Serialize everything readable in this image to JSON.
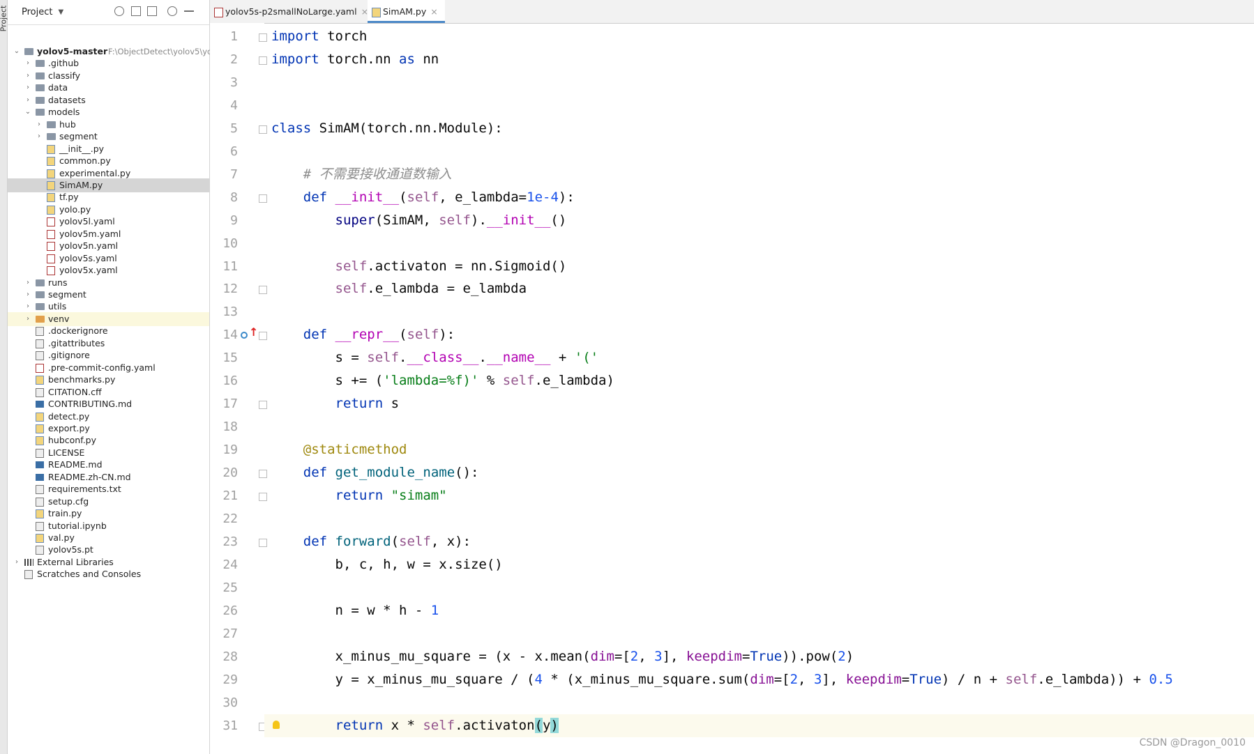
{
  "side_stripe": {
    "label": "Project"
  },
  "project_panel": {
    "title": "Project",
    "tree": [
      {
        "label": "yolov5-master",
        "hint": "F:\\ObjectDetect\\yolov5\\yol",
        "type": "folder",
        "depth": 0,
        "expanded": true,
        "bold": true
      },
      {
        "label": ".github",
        "type": "folder",
        "depth": 1
      },
      {
        "label": "classify",
        "type": "folder",
        "depth": 1
      },
      {
        "label": "data",
        "type": "folder",
        "depth": 1
      },
      {
        "label": "datasets",
        "type": "folder",
        "depth": 1
      },
      {
        "label": "models",
        "type": "folder",
        "depth": 1,
        "expanded": true
      },
      {
        "label": "hub",
        "type": "folder",
        "depth": 2
      },
      {
        "label": "segment",
        "type": "folder",
        "depth": 2
      },
      {
        "label": "__init__.py",
        "type": "py",
        "depth": 2,
        "leaf": true
      },
      {
        "label": "common.py",
        "type": "py",
        "depth": 2,
        "leaf": true
      },
      {
        "label": "experimental.py",
        "type": "py",
        "depth": 2,
        "leaf": true
      },
      {
        "label": "SimAM.py",
        "type": "py",
        "depth": 2,
        "leaf": true,
        "selected": true
      },
      {
        "label": "tf.py",
        "type": "py",
        "depth": 2,
        "leaf": true
      },
      {
        "label": "yolo.py",
        "type": "py",
        "depth": 2,
        "leaf": true
      },
      {
        "label": "yolov5l.yaml",
        "type": "yaml",
        "depth": 2,
        "leaf": true
      },
      {
        "label": "yolov5m.yaml",
        "type": "yaml",
        "depth": 2,
        "leaf": true
      },
      {
        "label": "yolov5n.yaml",
        "type": "yaml",
        "depth": 2,
        "leaf": true
      },
      {
        "label": "yolov5s.yaml",
        "type": "yaml",
        "depth": 2,
        "leaf": true
      },
      {
        "label": "yolov5x.yaml",
        "type": "yaml",
        "depth": 2,
        "leaf": true
      },
      {
        "label": "runs",
        "type": "folder",
        "depth": 1
      },
      {
        "label": "segment",
        "type": "folder",
        "depth": 1
      },
      {
        "label": "utils",
        "type": "folder",
        "depth": 1
      },
      {
        "label": "venv",
        "type": "folder-orange",
        "depth": 1,
        "highlight": true
      },
      {
        "label": ".dockerignore",
        "type": "txt",
        "depth": 1,
        "leaf": true
      },
      {
        "label": ".gitattributes",
        "type": "txt",
        "depth": 1,
        "leaf": true
      },
      {
        "label": ".gitignore",
        "type": "txt",
        "depth": 1,
        "leaf": true
      },
      {
        "label": ".pre-commit-config.yaml",
        "type": "yaml",
        "depth": 1,
        "leaf": true
      },
      {
        "label": "benchmarks.py",
        "type": "py",
        "depth": 1,
        "leaf": true
      },
      {
        "label": "CITATION.cff",
        "type": "txt",
        "depth": 1,
        "leaf": true
      },
      {
        "label": "CONTRIBUTING.md",
        "type": "md",
        "depth": 1,
        "leaf": true
      },
      {
        "label": "detect.py",
        "type": "py",
        "depth": 1,
        "leaf": true
      },
      {
        "label": "export.py",
        "type": "py",
        "depth": 1,
        "leaf": true
      },
      {
        "label": "hubconf.py",
        "type": "py",
        "depth": 1,
        "leaf": true
      },
      {
        "label": "LICENSE",
        "type": "txt",
        "depth": 1,
        "leaf": true
      },
      {
        "label": "README.md",
        "type": "md",
        "depth": 1,
        "leaf": true
      },
      {
        "label": "README.zh-CN.md",
        "type": "md",
        "depth": 1,
        "leaf": true
      },
      {
        "label": "requirements.txt",
        "type": "txt",
        "depth": 1,
        "leaf": true
      },
      {
        "label": "setup.cfg",
        "type": "txt",
        "depth": 1,
        "leaf": true
      },
      {
        "label": "train.py",
        "type": "py",
        "depth": 1,
        "leaf": true
      },
      {
        "label": "tutorial.ipynb",
        "type": "txt",
        "depth": 1,
        "leaf": true
      },
      {
        "label": "val.py",
        "type": "py",
        "depth": 1,
        "leaf": true
      },
      {
        "label": "yolov5s.pt",
        "type": "txt",
        "depth": 1,
        "leaf": true
      },
      {
        "label": "External Libraries",
        "type": "lib",
        "depth": 0
      },
      {
        "label": "Scratches and Consoles",
        "type": "scratch",
        "depth": 0,
        "leaf": true
      }
    ]
  },
  "tabs": [
    {
      "label": "yolov5s-p2smallNoLarge.yaml",
      "close": "×",
      "active": false
    },
    {
      "label": "SimAM.py",
      "close": "×",
      "active": true
    }
  ],
  "code_lines": [
    [
      [
        "kw",
        "import"
      ],
      [
        "p",
        " torch"
      ]
    ],
    [
      [
        "kw",
        "import"
      ],
      [
        "p",
        " torch.nn "
      ],
      [
        "kw",
        "as"
      ],
      [
        "p",
        " nn"
      ]
    ],
    [],
    [],
    [
      [
        "kw",
        "class"
      ],
      [
        "p",
        " SimAM(torch.nn.Module):"
      ]
    ],
    [],
    [
      [
        "p",
        "    "
      ],
      [
        "cmt",
        "# 不需要接收通道数输入"
      ]
    ],
    [
      [
        "p",
        "    "
      ],
      [
        "kw",
        "def"
      ],
      [
        "p",
        " "
      ],
      [
        "magic",
        "__init__"
      ],
      [
        "p",
        "("
      ],
      [
        "self",
        "self"
      ],
      [
        "p",
        ", e_lambda="
      ],
      [
        "num",
        "1e-4"
      ],
      [
        "p",
        "):"
      ]
    ],
    [
      [
        "p",
        "        "
      ],
      [
        "bi",
        "super"
      ],
      [
        "p",
        "(SimAM, "
      ],
      [
        "self",
        "self"
      ],
      [
        "p",
        ")."
      ],
      [
        "magic",
        "__init__"
      ],
      [
        "p",
        "()"
      ]
    ],
    [],
    [
      [
        "p",
        "        "
      ],
      [
        "self",
        "self"
      ],
      [
        "p",
        ".activaton = nn.Sigmoid()"
      ]
    ],
    [
      [
        "p",
        "        "
      ],
      [
        "self",
        "self"
      ],
      [
        "p",
        ".e_lambda = e_lambda"
      ]
    ],
    [],
    [
      [
        "p",
        "    "
      ],
      [
        "kw",
        "def"
      ],
      [
        "p",
        " "
      ],
      [
        "magic",
        "__repr__"
      ],
      [
        "p",
        "("
      ],
      [
        "self",
        "self"
      ],
      [
        "p",
        "):"
      ]
    ],
    [
      [
        "p",
        "        s = "
      ],
      [
        "self",
        "self"
      ],
      [
        "p",
        "."
      ],
      [
        "magic",
        "__class__"
      ],
      [
        "p",
        "."
      ],
      [
        "magic",
        "__name__"
      ],
      [
        "p",
        " + "
      ],
      [
        "str",
        "'('"
      ]
    ],
    [
      [
        "p",
        "        s += ("
      ],
      [
        "str",
        "'lambda=%f)'"
      ],
      [
        "p",
        " % "
      ],
      [
        "self",
        "self"
      ],
      [
        "p",
        ".e_lambda)"
      ]
    ],
    [
      [
        "p",
        "        "
      ],
      [
        "kw",
        "return"
      ],
      [
        "p",
        " s"
      ]
    ],
    [],
    [
      [
        "p",
        "    "
      ],
      [
        "dec",
        "@staticmethod"
      ]
    ],
    [
      [
        "p",
        "    "
      ],
      [
        "kw",
        "def"
      ],
      [
        "p",
        " "
      ],
      [
        "fn",
        "get_module_name"
      ],
      [
        "p",
        "():"
      ]
    ],
    [
      [
        "p",
        "        "
      ],
      [
        "kw",
        "return"
      ],
      [
        "p",
        " "
      ],
      [
        "str",
        "\"simam\""
      ]
    ],
    [],
    [
      [
        "p",
        "    "
      ],
      [
        "kw",
        "def"
      ],
      [
        "p",
        " "
      ],
      [
        "fn",
        "forward"
      ],
      [
        "p",
        "("
      ],
      [
        "self",
        "self"
      ],
      [
        "p",
        ", x):"
      ]
    ],
    [
      [
        "p",
        "        b, c, h, w = x.size()"
      ]
    ],
    [],
    [
      [
        "p",
        "        n = w * h - "
      ],
      [
        "num",
        "1"
      ]
    ],
    [],
    [
      [
        "p",
        "        x_minus_mu_square = (x - x.mean("
      ],
      [
        "param",
        "dim"
      ],
      [
        "p",
        "=["
      ],
      [
        "num",
        "2"
      ],
      [
        "p",
        ", "
      ],
      [
        "num",
        "3"
      ],
      [
        "p",
        "], "
      ],
      [
        "param",
        "keepdim"
      ],
      [
        "p",
        "="
      ],
      [
        "kw",
        "True"
      ],
      [
        "p",
        ")).pow("
      ],
      [
        "num",
        "2"
      ],
      [
        "p",
        ")"
      ]
    ],
    [
      [
        "p",
        "        y = x_minus_mu_square / ("
      ],
      [
        "num",
        "4"
      ],
      [
        "p",
        " * (x_minus_mu_square.sum("
      ],
      [
        "param",
        "dim"
      ],
      [
        "p",
        "=["
      ],
      [
        "num",
        "2"
      ],
      [
        "p",
        ", "
      ],
      [
        "num",
        "3"
      ],
      [
        "p",
        "], "
      ],
      [
        "param",
        "keepdim"
      ],
      [
        "p",
        "="
      ],
      [
        "kw",
        "True"
      ],
      [
        "p",
        ") / n + "
      ],
      [
        "self",
        "self"
      ],
      [
        "p",
        ".e_lambda)) + "
      ],
      [
        "num",
        "0.5"
      ]
    ],
    [],
    [
      [
        "p",
        "        "
      ],
      [
        "kw",
        "return"
      ],
      [
        "p",
        " x * "
      ],
      [
        "self",
        "self"
      ],
      [
        "p",
        ".activaton"
      ],
      [
        "hl",
        "("
      ],
      [
        "p",
        "y"
      ],
      [
        "hl",
        ")"
      ]
    ]
  ],
  "caret_line": 31,
  "watermark": "CSDN @Dragon_0010"
}
